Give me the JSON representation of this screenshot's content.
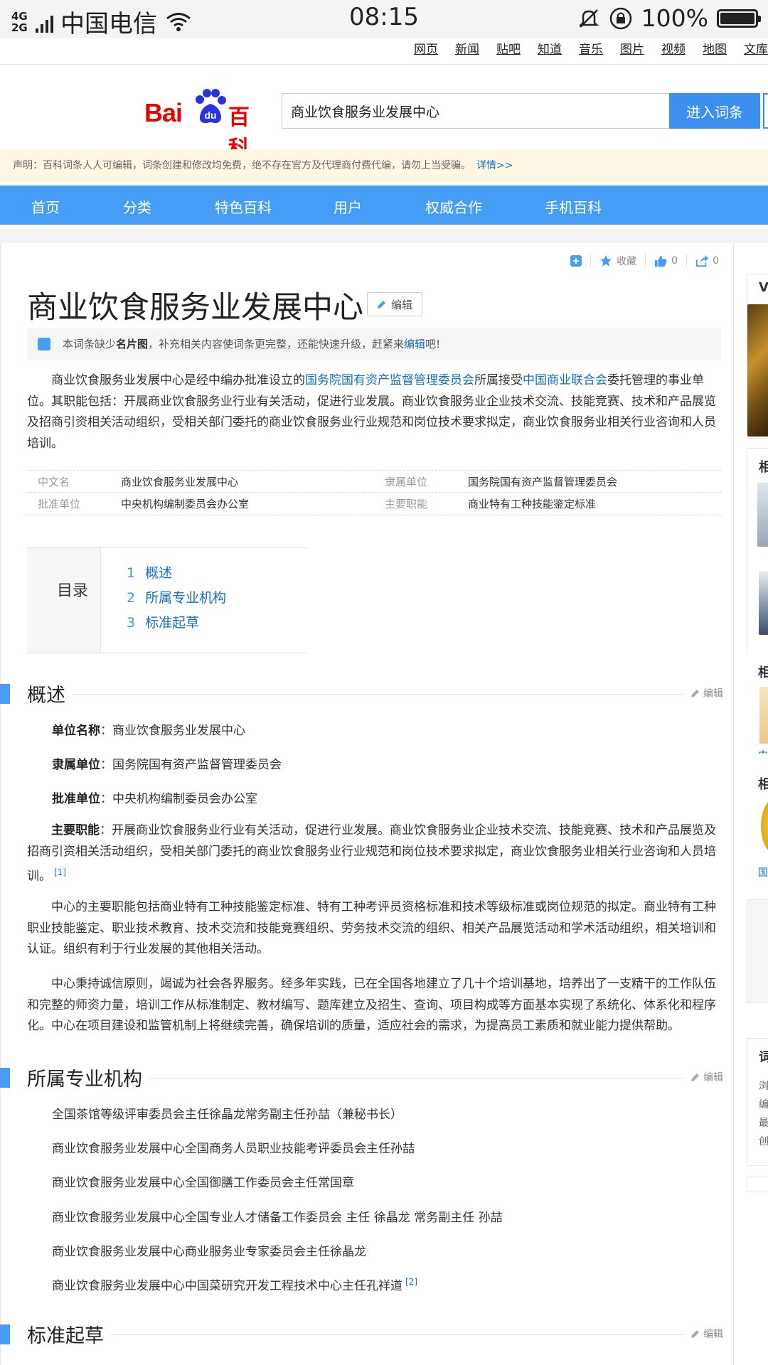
{
  "status_bar": {
    "network_top": "4G",
    "network_bottom": "2G",
    "carrier": "中国电信",
    "time": "08:15",
    "battery_percent": "100%",
    "battery_level": 1.0
  },
  "top_links": [
    "网页",
    "新闻",
    "贴吧",
    "知道",
    "音乐",
    "图片",
    "视频",
    "地图",
    "文库"
  ],
  "header": {
    "logo_bai": "Bai",
    "logo_du": "du",
    "logo_baike": "百科",
    "search_value": "商业饮食服务业发展中心",
    "search_button": "进入词条"
  },
  "notice": {
    "text": "声明：百科词条人人可编辑，词条创建和修改均免费，绝不存在官方及代理商付费代编，请勿上当受骗。",
    "link": "详情>>"
  },
  "main_nav": [
    "首页",
    "分类",
    "特色百科",
    "用户",
    "权威合作",
    "手机百科"
  ],
  "tools": {
    "favorite_label": "收藏",
    "like_count": "0",
    "share_count": "0"
  },
  "article": {
    "title": "商业饮食服务业发展中心",
    "edit_label": "编辑",
    "tip": {
      "prefix": "本词条缺少",
      "bold": "名片图",
      "middle": "，补充相关内容使词条更完整，还能快速升级，赶紧来",
      "link": "编辑",
      "suffix": "吧!"
    },
    "summary": {
      "p1": "商业饮食服务业发展中心是经中编办批准设立的",
      "link1": "国务院国有资产监督管理委员会",
      "p2": "所属接受",
      "link2": "中国商业联合会",
      "p3": "委托管理的事业单位。其职能包括：开展商业饮食服务业行业有关活动，促进行业发展。商业饮食服务业企业技术交流、技能竞赛、技术和产品展览及招商引资相关活动组织，受相关部门委托的商业饮食服务业行业规范和岗位技术要求拟定，商业饮食服务业相关行业咨询和人员培训。"
    },
    "infobox": [
      {
        "k1": "中文名",
        "v1": "商业饮食服务业发展中心",
        "k2": "隶属单位",
        "v2": "国务院国有资产监督管理委员会"
      },
      {
        "k1": "批准单位",
        "v1": "中央机构编制委员会办公室",
        "k2": "主要职能",
        "v2": "商业特有工种技能鉴定标准"
      }
    ],
    "toc": {
      "label": "目录",
      "items": [
        {
          "num": "1",
          "label": "概述"
        },
        {
          "num": "2",
          "label": "所属专业机构"
        },
        {
          "num": "3",
          "label": "标准起草"
        }
      ]
    },
    "sections": {
      "overview": {
        "title": "概述",
        "edit": "编辑",
        "unit_name_key": "单位名称",
        "unit_name_val": "：商业饮食服务业发展中心",
        "affiliation_key": "隶属单位",
        "affiliation_val": "：国务院国有资产监督管理委员会",
        "approval_key": "批准单位",
        "approval_val": "：中央机构编制委员会办公室",
        "duty_key": "主要职能",
        "duty_val": "：开展商业饮食服务业行业有关活动，促进行业发展。商业饮食服务业企业技术交流、技能竞赛、技术和产品展览及招商引资相关活动组织，受相关部门委托的商业饮食服务业行业规范和岗位技术要求拟定，商业饮食服务业相关行业咨询和人员培训。",
        "duty_ref": "[1]",
        "p1": "中心的主要职能包括商业特有工种技能鉴定标准、特有工种考评员资格标准和技术等级标准或岗位规范的拟定。商业特有工种职业技能鉴定、职业技术教育、技术交流和技能竞赛组织、劳务技术交流的组织、相关产品展览活动和学术活动组织，相关培训和认证。组织有利于行业发展的其他相关活动。",
        "p2": "中心秉持诚信原则，竭诚为社会各界服务。经多年实践，已在全国各地建立了几十个培训基地，培养出了一支精干的工作队伍和完整的师资力量，培训工作从标准制定、教材编写、题库建立及招生、查询、项目构成等方面基本实现了系统化、体系化和程序化。中心在项目建设和监管机制上将继续完善，确保培训的质量，适应社会的需求，为提高员工素质和就业能力提供帮助。"
      },
      "orgs": {
        "title": "所属专业机构",
        "edit": "编辑",
        "items": [
          "全国茶馆等级评审委员会主任徐晶龙常务副主任孙喆（兼秘书长）",
          "商业饮食服务业发展中心全国商务人员职业技能考评委员会主任孙喆",
          "商业饮食服务业发展中心全国御膳工作委员会主任常国章",
          "商业饮食服务业发展中心全国专业人才储备工作委员会 主任 徐晶龙 常务副主任 孙喆",
          "商业饮食服务业发展中心商业服务业专家委员会主任徐晶龙",
          "商业饮食服务业发展中心中国菜研究开发工程技术中心主任孔祥道"
        ],
        "last_ref": "[2]"
      },
      "standards": {
        "title": "标准起草",
        "edit": "编辑"
      }
    }
  },
  "sidebar": {
    "v": "V",
    "xiang1": "相",
    "xiang2": "相",
    "xiang3": "相",
    "zhong": "中",
    "guo": "国",
    "ci": "词",
    "liu": "浏",
    "bian": "编",
    "zui": "最",
    "chuang": "创"
  }
}
